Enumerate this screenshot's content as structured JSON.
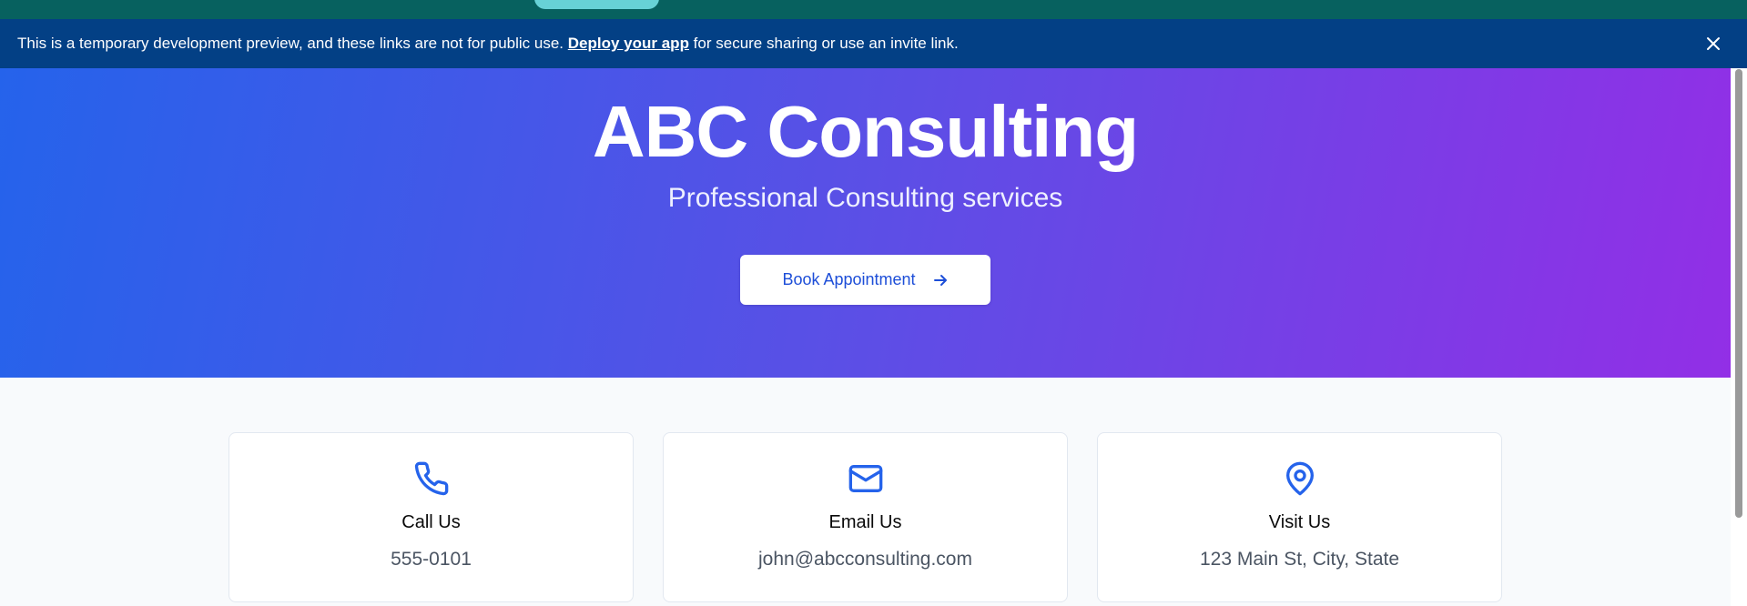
{
  "banner": {
    "text_before": "This is a temporary development preview, and these links are not for public use. ",
    "link_label": "Deploy your app",
    "text_after": " for secure sharing or use an invite link."
  },
  "hero": {
    "title": "ABC Consulting",
    "subtitle": "Professional Consulting services",
    "cta_label": "Book Appointment"
  },
  "contact_cards": [
    {
      "icon": "phone-icon",
      "title": "Call Us",
      "value": "555-0101"
    },
    {
      "icon": "mail-icon",
      "title": "Email Us",
      "value": "john@abcconsulting.com"
    },
    {
      "icon": "map-pin-icon",
      "title": "Visit Us",
      "value": "123 Main St, City, State"
    }
  ],
  "colors": {
    "banner_bg": "#034085",
    "top_strip": "#07615f",
    "hero_gradient_start": "#2563eb",
    "hero_gradient_end": "#922fe6",
    "accent": "#1d4ed8"
  }
}
